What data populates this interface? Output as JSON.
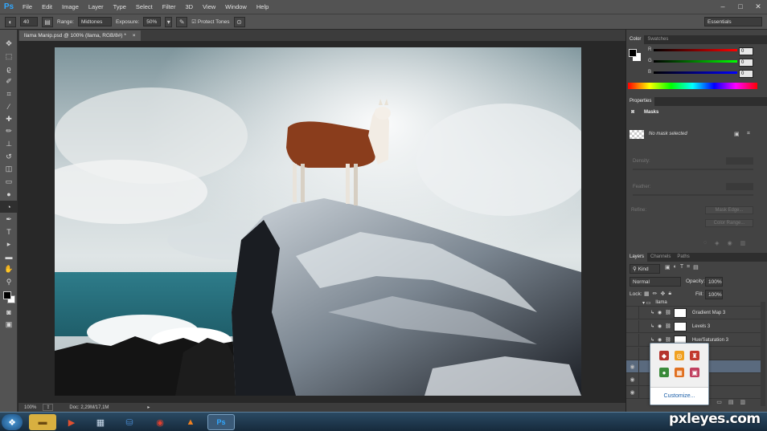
{
  "menubar": {
    "logo": "Ps",
    "items": [
      "File",
      "Edit",
      "Image",
      "Layer",
      "Type",
      "Select",
      "Filter",
      "3D",
      "View",
      "Window",
      "Help"
    ]
  },
  "options": {
    "brush_size": "40",
    "range_label": "Range:",
    "range_value": "Midtones",
    "exposure_label": "Exposure:",
    "exposure_value": "50%",
    "protect_tones": "Protect Tones",
    "workspace": "Essentials"
  },
  "document": {
    "tab_title": "llama Manip.psd @ 100% (llama, RGB/8#) *",
    "close_glyph": "×"
  },
  "status": {
    "zoom": "100%",
    "doc": "Doc: 2,29M/17,1M"
  },
  "color_panel": {
    "tabs": [
      "Color",
      "Swatches"
    ],
    "r_label": "R",
    "g_label": "G",
    "b_label": "B",
    "r": "0",
    "g": "0",
    "b": "0"
  },
  "properties": {
    "tab": "Properties",
    "title": "Masks",
    "no_mask": "No mask selected",
    "density": "Density:",
    "feather": "Feather:",
    "refine": "Refine:",
    "mask_edge": "Mask Edge...",
    "color_range": "Color Range..."
  },
  "layers_panel": {
    "tabs": [
      "Layers",
      "Channels",
      "Paths"
    ],
    "kind": "Kind",
    "blend": "Normal",
    "opacity_label": "Opacity:",
    "opacity": "100%",
    "lock_label": "Lock:",
    "fill_label": "Fill:",
    "fill": "100%",
    "group": "llama",
    "layers": [
      "Gradient Map 3",
      "Levels 3",
      "Hue/Saturation 3"
    ]
  },
  "popup": {
    "customize": "Customize..."
  },
  "watermark": "pxleyes.com",
  "colors": {
    "ps_blue": "#31a8ff",
    "panel": "#434343",
    "chrome": "#535353"
  }
}
